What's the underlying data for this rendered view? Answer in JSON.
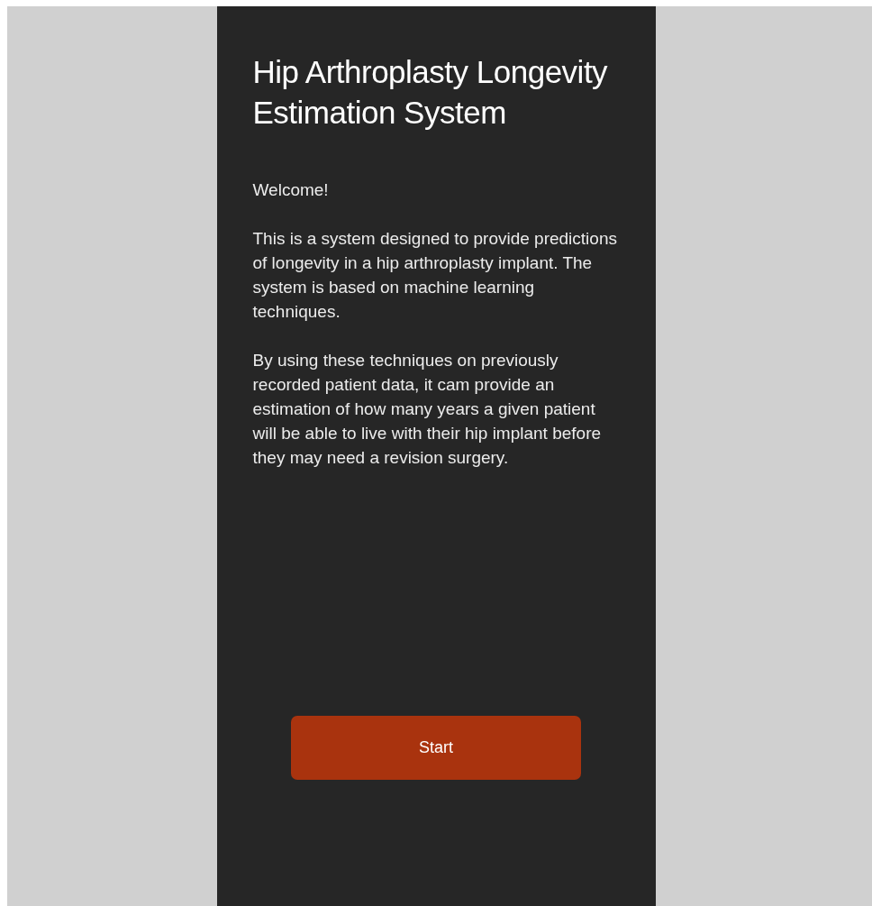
{
  "title": "Hip Arthroplasty Longevity Estimation System",
  "paragraphs": [
    "Welcome!",
    "This is a system designed to provide predictions of longevity in a hip arthroplasty implant. The system is based on machine learning techniques.",
    "By using these techniques on previously recorded patient data, it cam provide an estimation of how many years a given patient will be able to live with their hip implant before they may need a revision surgery."
  ],
  "button": {
    "label": "Start"
  }
}
